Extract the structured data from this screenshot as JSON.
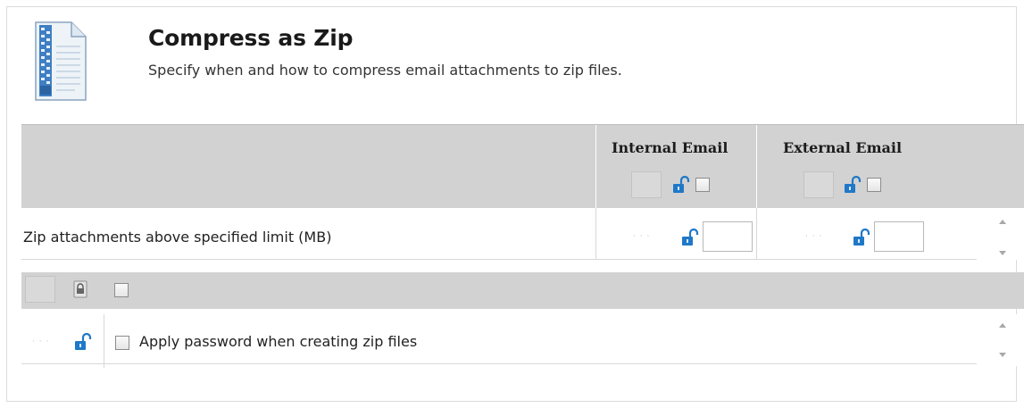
{
  "header": {
    "icon": "zip-document-icon",
    "title": "Compress as Zip",
    "subtitle": "Specify when and how to compress email attachments to zip files."
  },
  "columns": {
    "internal_label": "Internal Email",
    "external_label": "External Email"
  },
  "rows": [
    {
      "label": "Zip attachments above specified limit (MB)",
      "internal_value": "",
      "external_value": ""
    }
  ],
  "password_section": {
    "option_label": "Apply password when creating zip files",
    "checked": false
  },
  "icons": {
    "unlocked": "unlocked-padlock-icon",
    "locked": "locked-padlock-icon"
  },
  "colors": {
    "band": "#d2d2d2",
    "lock_blue": "#1f78c8"
  }
}
